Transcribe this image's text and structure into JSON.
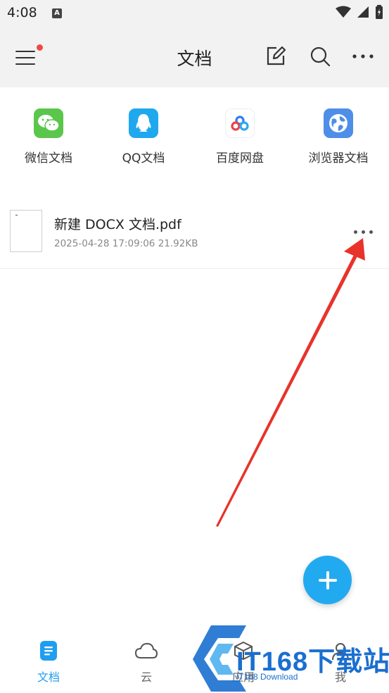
{
  "status_bar": {
    "time": "4:08",
    "notification_badge": "A",
    "icons": [
      "wifi-icon",
      "signal-icon",
      "battery-icon"
    ]
  },
  "header": {
    "title": "文档",
    "menu_has_badge": true,
    "actions": [
      "edit-icon",
      "search-icon",
      "more-icon"
    ]
  },
  "sources": [
    {
      "label": "微信文档",
      "icon": "wechat-icon",
      "color": "#5bc64c"
    },
    {
      "label": "QQ文档",
      "icon": "qq-icon",
      "color": "#1fa8ee"
    },
    {
      "label": "百度网盘",
      "icon": "baidu-netdisk-icon",
      "color": "#ffffff"
    },
    {
      "label": "浏览器文档",
      "icon": "browser-icon",
      "color": "#4e8ee8"
    }
  ],
  "files": [
    {
      "name": "新建 DOCX 文档.pdf",
      "date": "2025-04-28 17:09:06",
      "size": "21.92KB"
    }
  ],
  "fab": {
    "icon": "plus-icon",
    "color": "#22aaf0"
  },
  "bottom_nav": [
    {
      "label": "文档",
      "icon": "document-icon",
      "active": true
    },
    {
      "label": "云",
      "icon": "cloud-icon",
      "active": false
    },
    {
      "label": "应用",
      "icon": "apps-icon",
      "active": false
    },
    {
      "label": "我",
      "icon": "profile-icon",
      "active": false
    }
  ],
  "watermark": {
    "brand": "IT168下载站",
    "subtitle": "IT168 Download"
  },
  "colors": {
    "accent": "#1e9ef0",
    "annotation": "#e8332a",
    "badge": "#f04848"
  }
}
